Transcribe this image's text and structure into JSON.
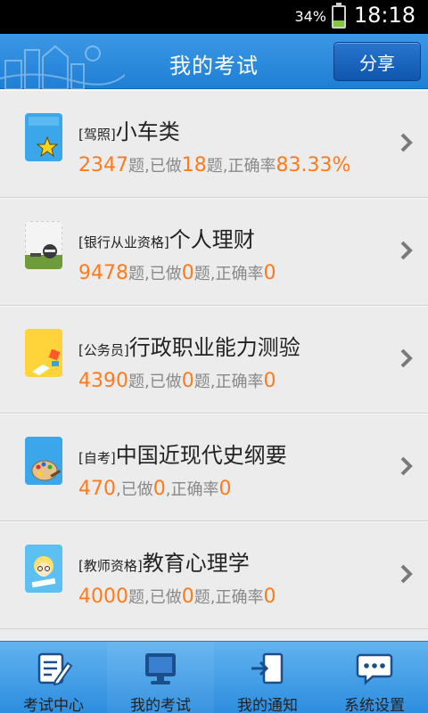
{
  "status_bar": {
    "battery_percent": "34%",
    "battery_level": 0.34,
    "time": "18:18"
  },
  "header": {
    "title": "我的考试",
    "share_label": "分享"
  },
  "exams": [
    {
      "category": "[驾照]",
      "name": "小车类",
      "total": "2347",
      "total_unit": "题,已做",
      "done": "18",
      "done_unit": "题,正确率",
      "rate": "83.33%",
      "icon": "star-card-icon"
    },
    {
      "category": "[银行从业资格]",
      "name": "个人理财",
      "total": "9478",
      "total_unit": "题,已做",
      "done": "0",
      "done_unit": "题,正确率",
      "rate": "0",
      "icon": "ninja-card-icon"
    },
    {
      "category": "[公务员]",
      "name": "行政职业能力测验",
      "total": "4390",
      "total_unit": "题,已做",
      "done": "0",
      "done_unit": "题,正确率",
      "rate": "0",
      "icon": "pencil-card-icon"
    },
    {
      "category": "[自考]",
      "name": "中国近现代史纲要",
      "total": "470",
      "total_unit": ",已做",
      "done": "0",
      "done_unit": ",正确率",
      "rate": "0",
      "icon": "palette-card-icon"
    },
    {
      "category": "[教师资格]",
      "name": "教育心理学",
      "total": "4000",
      "total_unit": "题,已做",
      "done": "0",
      "done_unit": "题,正确率",
      "rate": "0",
      "icon": "teacher-card-icon"
    }
  ],
  "bottom_nav": [
    {
      "label": "考试中心",
      "icon": "exam-center-icon"
    },
    {
      "label": "我的考试",
      "icon": "monitor-icon"
    },
    {
      "label": "我的通知",
      "icon": "notification-icon"
    },
    {
      "label": "系统设置",
      "icon": "settings-chat-icon"
    }
  ],
  "colors": {
    "accent": "#ff7a1a",
    "header_blue": "#1f7fd4",
    "nav_blue": "#4aa4ea"
  }
}
